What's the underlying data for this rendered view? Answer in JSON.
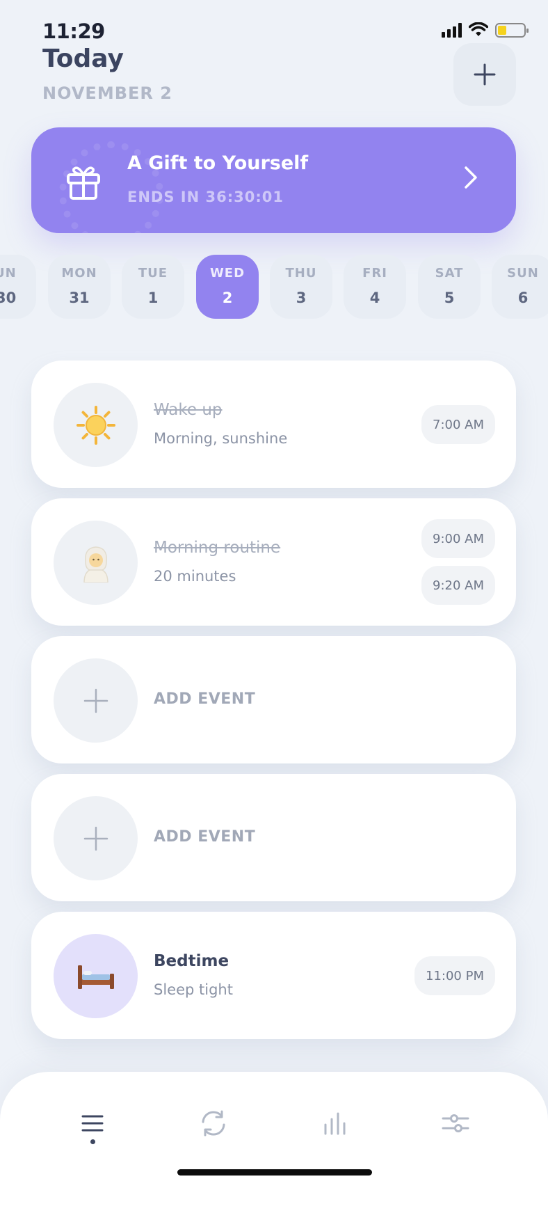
{
  "status_bar": {
    "time": "11:29"
  },
  "header": {
    "title": "Today",
    "date": "NOVEMBER 2"
  },
  "promo": {
    "title": "A Gift to Yourself",
    "subtitle": "ENDS IN 36:30:01"
  },
  "days": [
    {
      "name": "UN",
      "num": "30"
    },
    {
      "name": "MON",
      "num": "31"
    },
    {
      "name": "TUE",
      "num": "1"
    },
    {
      "name": "WED",
      "num": "2"
    },
    {
      "name": "THU",
      "num": "3"
    },
    {
      "name": "FRI",
      "num": "4"
    },
    {
      "name": "SAT",
      "num": "5"
    },
    {
      "name": "SUN",
      "num": "6"
    }
  ],
  "events": {
    "wake": {
      "title": "Wake up",
      "subtitle": "Morning, sunshine",
      "time": "7:00 AM",
      "icon": "sun-emoji-icon"
    },
    "routine": {
      "title": "Morning routine",
      "subtitle": "20 minutes",
      "time_start": "9:00 AM",
      "time_end": "9:20 AM",
      "icon": "person-emoji-icon"
    },
    "add1": {
      "label": "ADD EVENT"
    },
    "add2": {
      "label": "ADD EVENT"
    },
    "bedtime": {
      "title": "Bedtime",
      "subtitle": "Sleep tight",
      "time": "11:00 PM",
      "icon": "bed-emoji-icon"
    }
  },
  "colors": {
    "accent": "#9283ef",
    "background": "#eef2f8"
  }
}
